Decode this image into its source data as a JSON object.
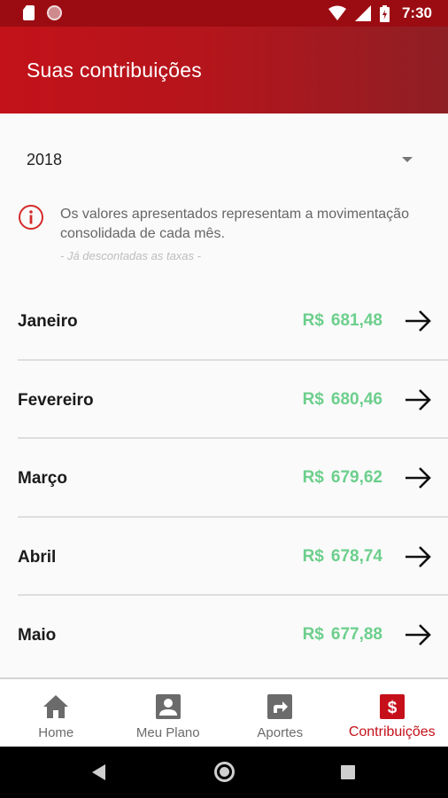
{
  "status_bar": {
    "time": "7:30"
  },
  "app_bar": {
    "title": "Suas contribuições"
  },
  "year_selector": {
    "value": "2018"
  },
  "info": {
    "text": "Os valores apresentados representam a movimentação consolidada de cada mês.",
    "note": "- Já descontadas as taxas -"
  },
  "months": [
    {
      "name": "Janeiro",
      "currency": "R$",
      "value": "681,48"
    },
    {
      "name": "Fevereiro",
      "currency": "R$",
      "value": "680,46"
    },
    {
      "name": "Março",
      "currency": "R$",
      "value": "679,62"
    },
    {
      "name": "Abril",
      "currency": "R$",
      "value": "678,74"
    },
    {
      "name": "Maio",
      "currency": "R$",
      "value": "677,88"
    }
  ],
  "bottom_nav": [
    {
      "label": "Home",
      "icon": "home-icon",
      "active": false
    },
    {
      "label": "Meu Plano",
      "icon": "person-icon",
      "active": false
    },
    {
      "label": "Aportes",
      "icon": "forward-icon",
      "active": false
    },
    {
      "label": "Contribuições",
      "icon": "dollar-icon",
      "active": true
    }
  ],
  "colors": {
    "primary": "#c3121a",
    "status_bar": "#9b0c12",
    "amount_green": "#6ccf8c",
    "active_tab": "#c5101a"
  }
}
